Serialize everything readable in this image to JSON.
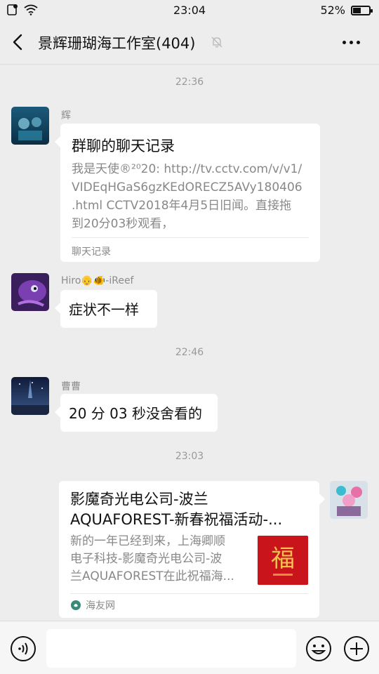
{
  "status_bar": {
    "time": "23:04",
    "battery_percent": "52%",
    "battery_level": 0.52
  },
  "header": {
    "title": "景辉珊瑚海工作室(404)",
    "back_icon": "chevron-left-icon",
    "mute_icon": "bell-muted-icon",
    "more_icon": "ellipsis-icon"
  },
  "messages": {
    "ts1": "22:36",
    "m1": {
      "sender": "辉",
      "card_title": "群聊的聊天记录",
      "card_lines": [
        "我是天使®²⁰20: http://tv.cctv.com/v/v1/",
        "VIDEqHGaS6gzKEdORECZ5AVy180406",
        ".html CCTV2018年4月5日旧闻。直接拖",
        "到20分03秒观看，"
      ],
      "card_footer": "聊天记录"
    },
    "m2": {
      "sender": "Hiro👴🐠-iReef",
      "text": "症状不一样"
    },
    "ts2": "22:46",
    "m3": {
      "sender": "曹曹",
      "text": "20 分 03 秒没舍看的"
    },
    "ts3": "23:03",
    "m4": {
      "title_lines": [
        "影魔奇光电公司-波兰",
        "AQUAFOREST-新春祝福活动-..."
      ],
      "desc_lines": [
        "新的一年已经到来，上海卿顺",
        "电子科技-影魔奇光电公司-波",
        "兰AQUAFOREST在此祝福海..."
      ],
      "thumb_char": "福",
      "source": "海友网"
    }
  },
  "colors": {
    "background": "#ededed",
    "bubble": "#ffffff",
    "timestamp": "#999999",
    "thumb_red": "#c9141c"
  }
}
